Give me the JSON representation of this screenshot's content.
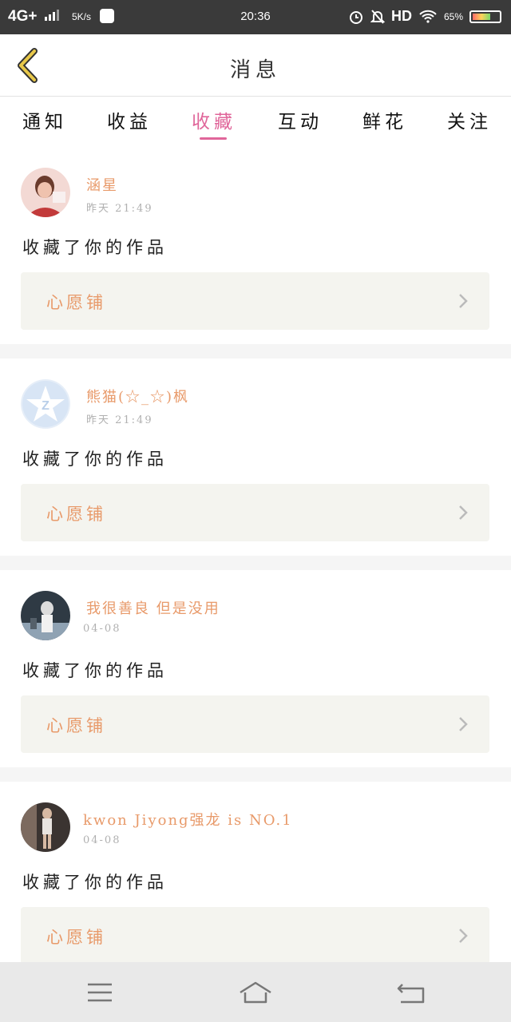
{
  "status_bar": {
    "network": "4G+",
    "speed": "5K/s",
    "time": "20:36",
    "hd": "HD",
    "battery": "65%",
    "icons": [
      "signal-icon",
      "app-notification-icon",
      "alarm-icon",
      "mute-bell-icon",
      "wifi-icon",
      "battery-icon"
    ]
  },
  "header": {
    "title": "消息",
    "back_icon": "chevron-left-icon",
    "accent": "#e8c84a"
  },
  "tabs": [
    {
      "label": "通知",
      "active": false
    },
    {
      "label": "收益",
      "active": false
    },
    {
      "label": "收藏",
      "active": true
    },
    {
      "label": "互动",
      "active": false
    },
    {
      "label": "鲜花",
      "active": false
    },
    {
      "label": "关注",
      "active": false
    }
  ],
  "messages": [
    {
      "user": "涵星",
      "time": "昨天 21:49",
      "action": "收藏了你的作品",
      "work": "心愿铺"
    },
    {
      "user": "熊猫(☆_☆)枫",
      "time": "昨天 21:49",
      "action": "收藏了你的作品",
      "work": "心愿铺"
    },
    {
      "user": "我很善良 但是没用",
      "time": "04-08",
      "action": "收藏了你的作品",
      "work": "心愿铺"
    },
    {
      "user": "kwon Jiyong强龙 is NO.1",
      "time": "04-08",
      "action": "收藏了你的作品",
      "work": "心愿铺"
    }
  ],
  "colors": {
    "active_tab": "#e0669a",
    "username": "#e89a6a",
    "work_box_bg": "#f4f4ef",
    "status_bar_bg": "#3a3a3a",
    "nav_bar_bg": "#e9e9e9"
  },
  "nav_bar": {
    "icons": [
      "menu-icon",
      "home-icon",
      "back-icon"
    ]
  }
}
